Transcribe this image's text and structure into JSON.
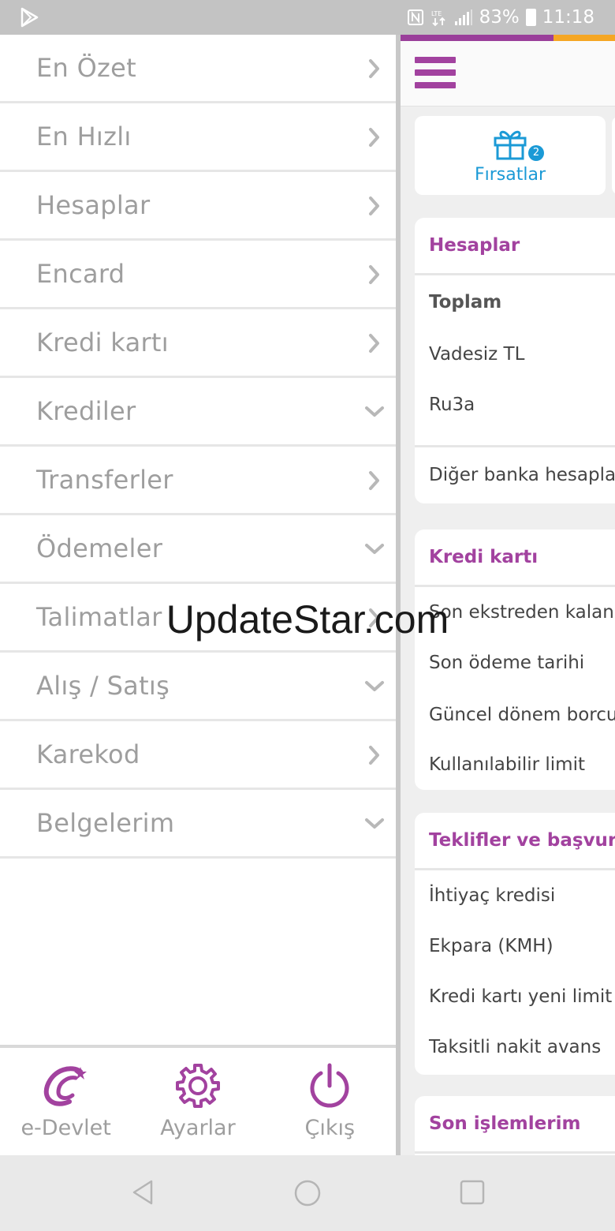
{
  "status_bar": {
    "battery_percent": "83%",
    "time": "11:18",
    "icons": [
      "play-store-icon",
      "nfc-icon",
      "lte-icon",
      "signal-icon",
      "battery-icon"
    ]
  },
  "drawer": {
    "items": [
      {
        "label": "En Özet",
        "chevron": "chevron-right-icon"
      },
      {
        "label": "En Hızlı",
        "chevron": "chevron-right-icon"
      },
      {
        "label": "Hesaplar",
        "chevron": "chevron-right-icon"
      },
      {
        "label": "Encard",
        "chevron": "chevron-right-icon"
      },
      {
        "label": "Kredi kartı",
        "chevron": "chevron-right-icon"
      },
      {
        "label": "Krediler",
        "chevron": "chevron-down-icon"
      },
      {
        "label": "Transferler",
        "chevron": "chevron-right-icon"
      },
      {
        "label": "Ödemeler",
        "chevron": "chevron-down-icon"
      },
      {
        "label": "Talimatlar",
        "chevron": "chevron-right-icon"
      },
      {
        "label": "Alış / Satış",
        "chevron": "chevron-down-icon"
      },
      {
        "label": "Karekod",
        "chevron": "chevron-right-icon"
      },
      {
        "label": "Belgelerim",
        "chevron": "chevron-down-icon"
      }
    ],
    "bottom": {
      "edevlet_label": "e-Devlet",
      "settings_label": "Ayarlar",
      "logout_label": "Çıkış"
    }
  },
  "main": {
    "promo": {
      "label": "Fırsatlar",
      "badge": "2"
    },
    "accounts": {
      "title": "Hesaplar",
      "rows": [
        "Toplam",
        "Vadesiz TL",
        "Ru3a"
      ],
      "footer": "Diğer banka hesapla"
    },
    "credit_card": {
      "title": "Kredi kartı",
      "rows": [
        "Son ekstreden kalan",
        "Son ödeme tarihi",
        "Güncel dönem borcu",
        "Kullanılabilir limit"
      ]
    },
    "offers": {
      "title": "Teklifler ve başvurul",
      "rows": [
        "İhtiyaç kredisi",
        "Ekpara (KMH)",
        "Kredi kartı yeni limit",
        "Taksitli nakit avans"
      ]
    },
    "recent": {
      "title": "Son işlemlerim"
    }
  },
  "watermark": "UpdateStar.com",
  "colors": {
    "accent_purple": "#a2429f",
    "accent_orange": "#f5a623",
    "link_blue": "#1b9ad6"
  }
}
